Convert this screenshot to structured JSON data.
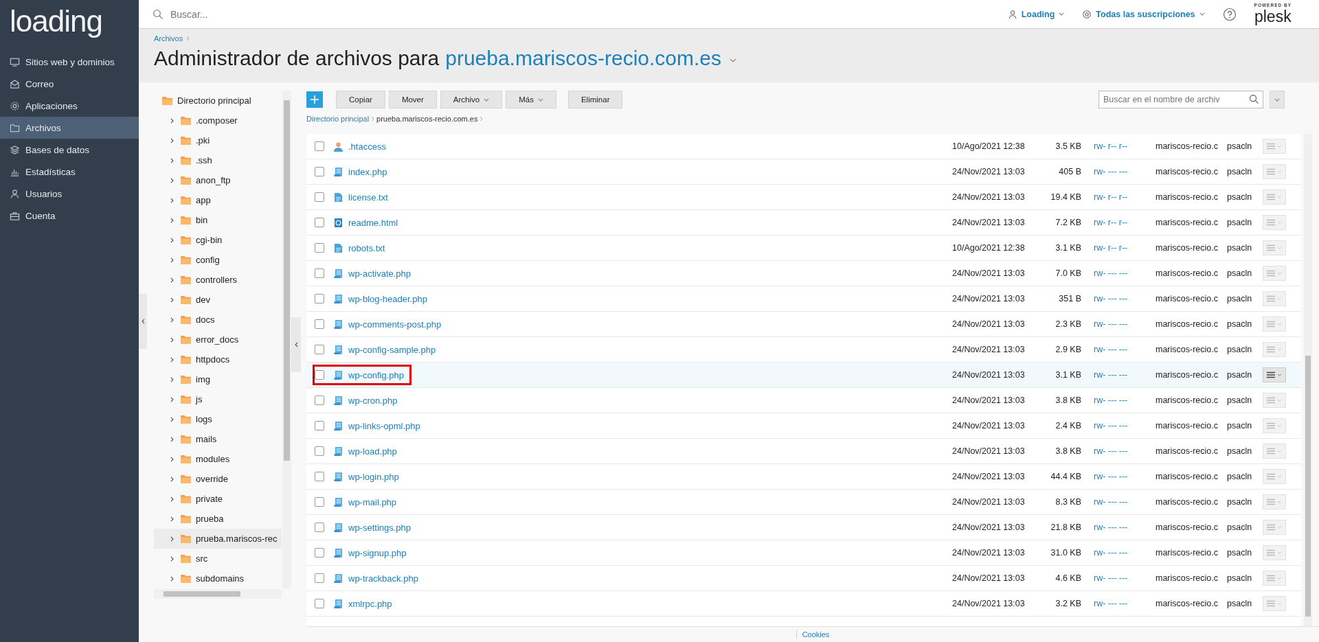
{
  "sidebar": {
    "logo": "loading",
    "items": [
      {
        "label": "Sitios web y dominios",
        "selected": false
      },
      {
        "label": "Correo",
        "selected": false
      },
      {
        "label": "Aplicaciones",
        "selected": false
      },
      {
        "label": "Archivos",
        "selected": true
      },
      {
        "label": "Bases de datos",
        "selected": false
      },
      {
        "label": "Estadísticas",
        "selected": false
      },
      {
        "label": "Usuarios",
        "selected": false
      },
      {
        "label": "Cuenta",
        "selected": false
      }
    ]
  },
  "topbar": {
    "search_placeholder": "Buscar...",
    "user": "Loading",
    "subscriptions": "Todas las suscripciones",
    "brand_caption": "POWERED BY",
    "brand": "plesk"
  },
  "header": {
    "breadcrumb": [
      "Archivos"
    ],
    "title": "Administrador de archivos para",
    "domain": "prueba.mariscos-recio.com.es"
  },
  "tree": {
    "root": "Directorio principal",
    "children": [
      {
        "label": ".composer",
        "selected": false
      },
      {
        "label": ".pki",
        "selected": false
      },
      {
        "label": ".ssh",
        "selected": false
      },
      {
        "label": "anon_ftp",
        "selected": false
      },
      {
        "label": "app",
        "selected": false
      },
      {
        "label": "bin",
        "selected": false
      },
      {
        "label": "cgi-bin",
        "selected": false
      },
      {
        "label": "config",
        "selected": false
      },
      {
        "label": "controllers",
        "selected": false
      },
      {
        "label": "dev",
        "selected": false
      },
      {
        "label": "docs",
        "selected": false
      },
      {
        "label": "error_docs",
        "selected": false
      },
      {
        "label": "httpdocs",
        "selected": false
      },
      {
        "label": "img",
        "selected": false
      },
      {
        "label": "js",
        "selected": false
      },
      {
        "label": "logs",
        "selected": false
      },
      {
        "label": "mails",
        "selected": false
      },
      {
        "label": "modules",
        "selected": false
      },
      {
        "label": "override",
        "selected": false
      },
      {
        "label": "private",
        "selected": false
      },
      {
        "label": "prueba",
        "selected": false
      },
      {
        "label": "prueba.mariscos-rec",
        "selected": true
      },
      {
        "label": "src",
        "selected": false
      },
      {
        "label": "subdomains",
        "selected": false
      }
    ]
  },
  "toolbar": {
    "buttons": [
      {
        "label": "Copiar",
        "dropdown": false
      },
      {
        "label": "Mover",
        "dropdown": false
      },
      {
        "label": "Archivo",
        "dropdown": true
      },
      {
        "label": "Más",
        "dropdown": true
      },
      {
        "label": "Eliminar",
        "dropdown": false
      }
    ],
    "search_placeholder": "Buscar en el nombre de archiv"
  },
  "path": [
    "Directorio principal",
    "prueba.mariscos-recio.com.es"
  ],
  "files": [
    {
      "kind": "user",
      "name": ".htaccess",
      "modified": "10/Ago/2021 12:38",
      "size": "3.5 KB",
      "permissions": "rw- r-- r--",
      "user": "mariscos-recio.c",
      "group": "psacln",
      "checked": false,
      "highlighted": false
    },
    {
      "kind": "php",
      "name": "index.php",
      "modified": "24/Nov/2021 13:03",
      "size": "405 B",
      "permissions": "rw- --- ---",
      "user": "mariscos-recio.c",
      "group": "psacln",
      "checked": false,
      "highlighted": false
    },
    {
      "kind": "text",
      "name": "license.txt",
      "modified": "24/Nov/2021 13:03",
      "size": "19.4 KB",
      "permissions": "rw- r-- r--",
      "user": "mariscos-recio.c",
      "group": "psacln",
      "checked": false,
      "highlighted": false
    },
    {
      "kind": "html",
      "name": "readme.html",
      "modified": "24/Nov/2021 13:03",
      "size": "7.2 KB",
      "permissions": "rw- r-- r--",
      "user": "mariscos-recio.c",
      "group": "psacln",
      "checked": false,
      "highlighted": false
    },
    {
      "kind": "text",
      "name": "robots.txt",
      "modified": "10/Ago/2021 12:38",
      "size": "3.1 KB",
      "permissions": "rw- r-- r--",
      "user": "mariscos-recio.c",
      "group": "psacln",
      "checked": false,
      "highlighted": false
    },
    {
      "kind": "php",
      "name": "wp-activate.php",
      "modified": "24/Nov/2021 13:03",
      "size": "7.0 KB",
      "permissions": "rw- --- ---",
      "user": "mariscos-recio.c",
      "group": "psacln",
      "checked": false,
      "highlighted": false
    },
    {
      "kind": "php",
      "name": "wp-blog-header.php",
      "modified": "24/Nov/2021 13:03",
      "size": "351 B",
      "permissions": "rw- --- ---",
      "user": "mariscos-recio.c",
      "group": "psacln",
      "checked": false,
      "highlighted": false
    },
    {
      "kind": "php",
      "name": "wp-comments-post.php",
      "modified": "24/Nov/2021 13:03",
      "size": "2.3 KB",
      "permissions": "rw- --- ---",
      "user": "mariscos-recio.c",
      "group": "psacln",
      "checked": false,
      "highlighted": false
    },
    {
      "kind": "php",
      "name": "wp-config-sample.php",
      "modified": "24/Nov/2021 13:03",
      "size": "2.9 KB",
      "permissions": "rw- --- ---",
      "user": "mariscos-recio.c",
      "group": "psacln",
      "checked": false,
      "highlighted": false
    },
    {
      "kind": "php",
      "name": "wp-config.php",
      "modified": "24/Nov/2021 13:03",
      "size": "3.1 KB",
      "permissions": "rw- --- ---",
      "user": "mariscos-recio.c",
      "group": "psacln",
      "checked": false,
      "highlighted": true
    },
    {
      "kind": "php",
      "name": "wp-cron.php",
      "modified": "24/Nov/2021 13:03",
      "size": "3.8 KB",
      "permissions": "rw- --- ---",
      "user": "mariscos-recio.c",
      "group": "psacln",
      "checked": false,
      "highlighted": false
    },
    {
      "kind": "php",
      "name": "wp-links-opml.php",
      "modified": "24/Nov/2021 13:03",
      "size": "2.4 KB",
      "permissions": "rw- --- ---",
      "user": "mariscos-recio.c",
      "group": "psacln",
      "checked": false,
      "highlighted": false
    },
    {
      "kind": "php",
      "name": "wp-load.php",
      "modified": "24/Nov/2021 13:03",
      "size": "3.8 KB",
      "permissions": "rw- --- ---",
      "user": "mariscos-recio.c",
      "group": "psacln",
      "checked": false,
      "highlighted": false
    },
    {
      "kind": "php",
      "name": "wp-login.php",
      "modified": "24/Nov/2021 13:03",
      "size": "44.4 KB",
      "permissions": "rw- --- ---",
      "user": "mariscos-recio.c",
      "group": "psacln",
      "checked": false,
      "highlighted": false
    },
    {
      "kind": "php",
      "name": "wp-mail.php",
      "modified": "24/Nov/2021 13:03",
      "size": "8.3 KB",
      "permissions": "rw- --- ---",
      "user": "mariscos-recio.c",
      "group": "psacln",
      "checked": false,
      "highlighted": false
    },
    {
      "kind": "php",
      "name": "wp-settings.php",
      "modified": "24/Nov/2021 13:03",
      "size": "21.8 KB",
      "permissions": "rw- --- ---",
      "user": "mariscos-recio.c",
      "group": "psacln",
      "checked": false,
      "highlighted": false
    },
    {
      "kind": "php",
      "name": "wp-signup.php",
      "modified": "24/Nov/2021 13:03",
      "size": "31.0 KB",
      "permissions": "rw- --- ---",
      "user": "mariscos-recio.c",
      "group": "psacln",
      "checked": false,
      "highlighted": false
    },
    {
      "kind": "php",
      "name": "wp-trackback.php",
      "modified": "24/Nov/2021 13:03",
      "size": "4.6 KB",
      "permissions": "rw- --- ---",
      "user": "mariscos-recio.c",
      "group": "psacln",
      "checked": false,
      "highlighted": false
    },
    {
      "kind": "php",
      "name": "xmlrpc.php",
      "modified": "24/Nov/2021 13:03",
      "size": "3.2 KB",
      "permissions": "rw- --- ---",
      "user": "mariscos-recio.c",
      "group": "psacln",
      "checked": false,
      "highlighted": false
    }
  ],
  "footer": {
    "link": "Cookies"
  }
}
